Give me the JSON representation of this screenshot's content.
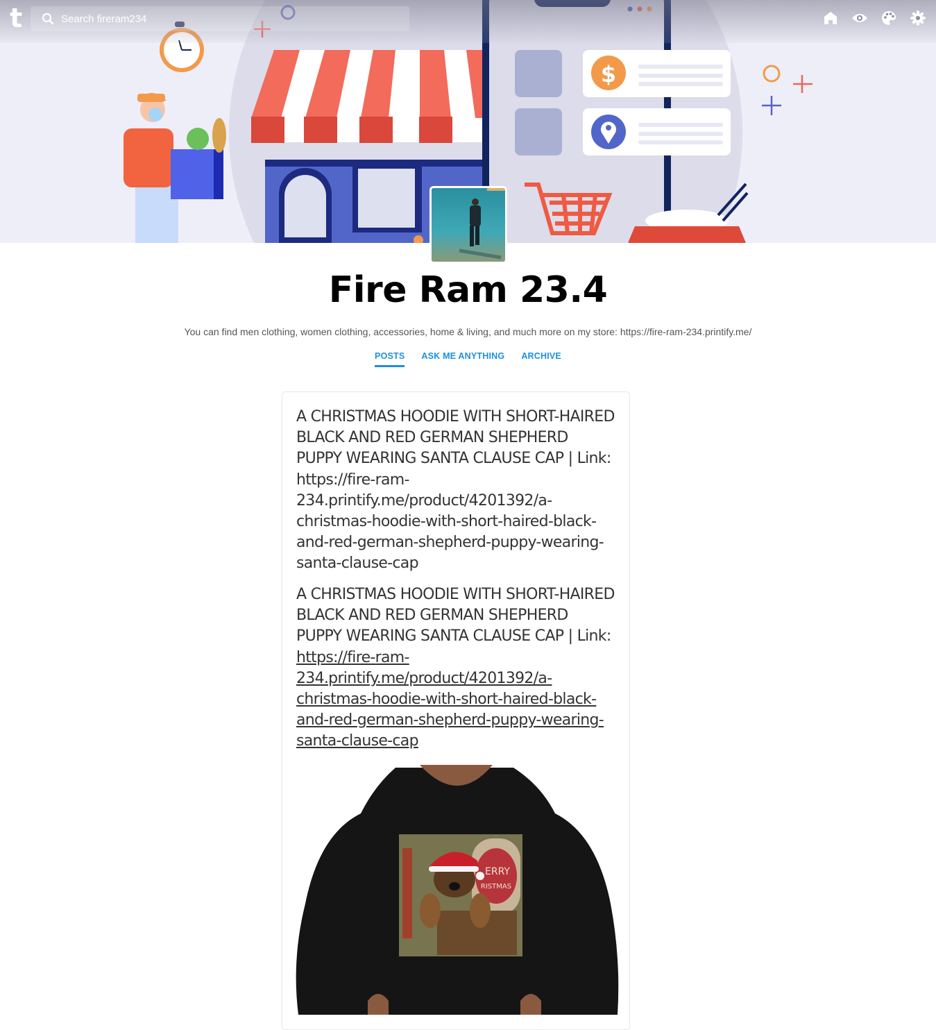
{
  "topbar": {
    "logo": "t",
    "search_placeholder": "Search fireram234",
    "icons": [
      "home-icon",
      "eye-icon",
      "palette-icon",
      "gear-icon"
    ]
  },
  "blog": {
    "title": "Fire Ram 23.4",
    "description": "You can find men clothing, women clothing, accessories, home & living, and much more on my store: https://fire-ram-234.printify.me/"
  },
  "nav": {
    "items": [
      {
        "label": "POSTS",
        "active": true
      },
      {
        "label": "ASK ME ANYTHING",
        "active": false
      },
      {
        "label": "ARCHIVE",
        "active": false
      }
    ]
  },
  "post": {
    "title_text": "A CHRISTMAS HOODIE WITH SHORT-HAIRED BLACK AND RED GERMAN SHEPHERD PUPPY WEARING SANTA CLAUSE CAP | Link: https://fire-ram-234.printify.me/product/4201392/a-christmas-hoodie-with-short-haired-black-and-red-german-shepherd-puppy-wearing-santa-clause-cap",
    "body_prefix": "A CHRISTMAS HOODIE WITH SHORT-HAIRED BLACK AND RED GERMAN SHEPHERD PUPPY WEARING SANTA CLAUSE CAP | Link: ",
    "body_link": "https://fire-ram-234.printify.me/product/4201392/a-christmas-hoodie-with-short-haired-black-and-red-german-shepherd-puppy-wearing-santa-clause-cap",
    "image_print_text": [
      "ERRY",
      "RISTMAS"
    ]
  },
  "colors": {
    "accent": "#1a8fe3",
    "banner_bg": "#eeeef8"
  }
}
